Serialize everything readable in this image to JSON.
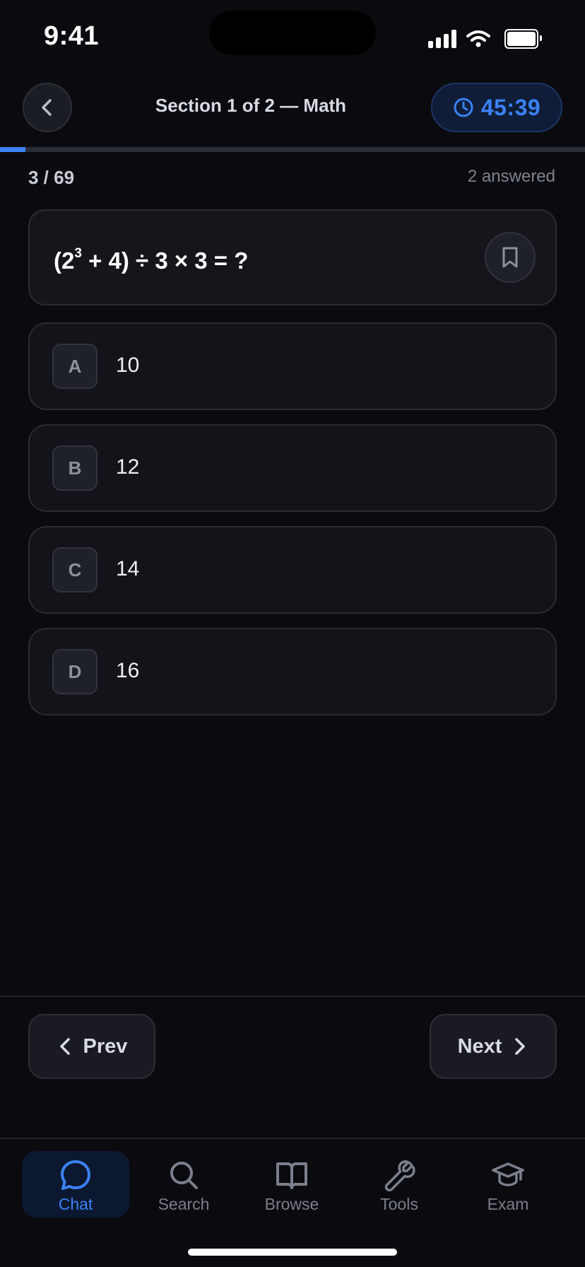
{
  "status_bar": {
    "time": "9:41"
  },
  "header": {
    "title": "Section 1 of 2 — Math",
    "timer": "45:39",
    "back_icon": "chevron-left-icon",
    "timer_icon": "clock-icon"
  },
  "progress": {
    "current": 3,
    "total": 69,
    "fraction": 0.0435,
    "counter_text": "3 / 69",
    "answered_text": "2 answered"
  },
  "question": {
    "base": "(2",
    "exponent": "3",
    "rest": " + 4) ÷ 3 × 3 = ?",
    "bookmark_icon": "bookmark-icon"
  },
  "options": [
    {
      "letter": "A",
      "text": "10"
    },
    {
      "letter": "B",
      "text": "12"
    },
    {
      "letter": "C",
      "text": "14"
    },
    {
      "letter": "D",
      "text": "16"
    }
  ],
  "navigation": {
    "prev_label": "Prev",
    "next_label": "Next"
  },
  "tabs": [
    {
      "label": "Chat",
      "icon": "chat-bubble-icon",
      "active": true
    },
    {
      "label": "Search",
      "icon": "search-icon",
      "active": false
    },
    {
      "label": "Browse",
      "icon": "book-icon",
      "active": false
    },
    {
      "label": "Tools",
      "icon": "wrench-icon",
      "active": false
    },
    {
      "label": "Exam",
      "icon": "graduation-cap-icon",
      "active": false
    }
  ],
  "colors": {
    "background": "#0b0b0f",
    "accent": "#3b82f6",
    "card": "#13141a",
    "border": "#2a2c34",
    "muted_text": "#7a7f8b"
  }
}
